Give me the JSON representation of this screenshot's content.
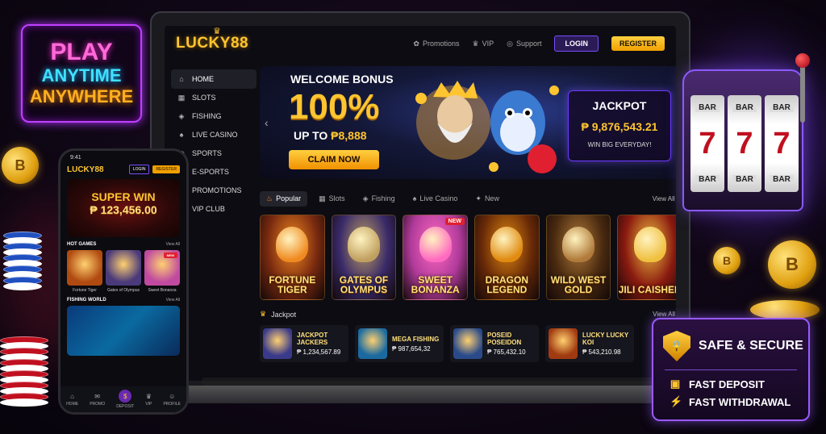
{
  "neon_sign": {
    "line1": "PLAY",
    "line2": "ANYTIME",
    "line3": "ANYWHERE"
  },
  "desktop": {
    "logo": "LUCKY88",
    "topnav": {
      "promotions": "Promotions",
      "vip": "VIP",
      "support": "Support",
      "login": "LOGIN",
      "register": "REGISTER"
    },
    "sidebar": [
      {
        "label": "HOME",
        "icon": "home-icon",
        "glyph": "⌂",
        "active": true
      },
      {
        "label": "SLOTS",
        "icon": "slots-icon",
        "glyph": "▦"
      },
      {
        "label": "FISHING",
        "icon": "fish-icon",
        "glyph": "◈"
      },
      {
        "label": "LIVE CASINO",
        "icon": "live-casino-icon",
        "glyph": "♠"
      },
      {
        "label": "SPORTS",
        "icon": "sports-icon",
        "glyph": "◎"
      },
      {
        "label": "E-SPORTS",
        "icon": "esports-icon",
        "glyph": ""
      },
      {
        "label": "PROMOTIONS",
        "icon": "gift-icon",
        "glyph": ""
      },
      {
        "label": "VIP CLUB",
        "icon": "crown-icon",
        "glyph": ""
      }
    ],
    "hero": {
      "title": "WELCOME BONUS",
      "percent": "100%",
      "upto_prefix": "UP TO ",
      "upto_amount": "₱8,888",
      "claim": "CLAIM NOW"
    },
    "jackpot_box": {
      "title": "JACKPOT",
      "amount": "₱ 9,876,543.21",
      "subtitle": "WIN BIG EVERYDAY!"
    },
    "tabs": [
      {
        "label": "Popular",
        "icon": "flame-icon",
        "glyph": "♨",
        "active": true
      },
      {
        "label": "Slots",
        "icon": "slots-icon",
        "glyph": "▦"
      },
      {
        "label": "Fishing",
        "icon": "fish-icon",
        "glyph": "◈"
      },
      {
        "label": "Live Casino",
        "icon": "live-casino-icon",
        "glyph": "♠"
      },
      {
        "label": "New",
        "icon": "new-icon",
        "glyph": "✦"
      }
    ],
    "view_all": "View All",
    "games": [
      {
        "title": "FORTUNE TIGER",
        "bg": "#7a2a10",
        "art": "#f08a20"
      },
      {
        "title": "GATES OF OLYMPUS",
        "bg": "#3a2a6a",
        "art": "#c0a060"
      },
      {
        "title": "SWEET BONANZA",
        "bg": "#b03a9a",
        "art": "#ff6ac0",
        "badge": "NEW"
      },
      {
        "title": "DRAGON LEGEND",
        "bg": "#6a2a08",
        "art": "#e08a10"
      },
      {
        "title": "WILD WEST GOLD",
        "bg": "#4a2a10",
        "art": "#b07a3a"
      },
      {
        "title": "JILI CAISHEN",
        "bg": "#8a1a10",
        "art": "#f0c040"
      }
    ],
    "jackpot_section": {
      "title": "Jackpot",
      "view_all": "View All",
      "items": [
        {
          "name": "JACKPOT JACKERS",
          "value": "₱ 1,234,567.89",
          "thumb": "#3a3a8a"
        },
        {
          "name": "MEGA FISHING",
          "value": "₱ 987,654,32",
          "thumb": "#1a6aa0"
        },
        {
          "name": "POSEID POSEIDON",
          "value": "₱ 765,432.10",
          "thumb": "#2a4a8a"
        },
        {
          "name": "LUCKY LUCKY KOI",
          "value": "₱ 543,210.98",
          "thumb": "#a03a10"
        }
      ]
    }
  },
  "phone": {
    "time": "9:41",
    "logo": "LUCKY88",
    "login": "LOGIN",
    "register": "REGISTER",
    "banner_title": "SUPER WIN",
    "banner_amount": "₱ 123,456.00",
    "hot_games_title": "HOT GAMES",
    "hot_games_view_all": "View All",
    "hot_games": [
      {
        "name": "Fortune Tiger",
        "thumb": "#b04a10"
      },
      {
        "name": "Gates of Olympus",
        "thumb": "#4a3a7a"
      },
      {
        "name": "Sweet Bonanza",
        "thumb": "#c04aa0",
        "badge": "NEW"
      }
    ],
    "fishing_title": "FISHING WORLD",
    "fishing_view_all": "View All",
    "nav": [
      {
        "label": "HOME",
        "icon": "home-icon",
        "glyph": "⌂"
      },
      {
        "label": "PROMO",
        "icon": "gift-icon",
        "glyph": "✉"
      },
      {
        "label": "DEPOSIT",
        "icon": "deposit-icon",
        "glyph": "$",
        "center": true
      },
      {
        "label": "VIP",
        "icon": "crown-icon",
        "glyph": "♛"
      },
      {
        "label": "PROFILE",
        "icon": "user-icon",
        "glyph": "☺"
      }
    ]
  },
  "slot_machine": {
    "bar": "BAR",
    "seven": "7"
  },
  "safe_panel": {
    "title": "SAFE & SECURE",
    "row1": "FAST DEPOSIT",
    "row2": "FAST WITHDRAWAL"
  },
  "colors": {
    "gold": "#ffc530",
    "purple_accent": "#7a4cff",
    "background": "#120818"
  }
}
